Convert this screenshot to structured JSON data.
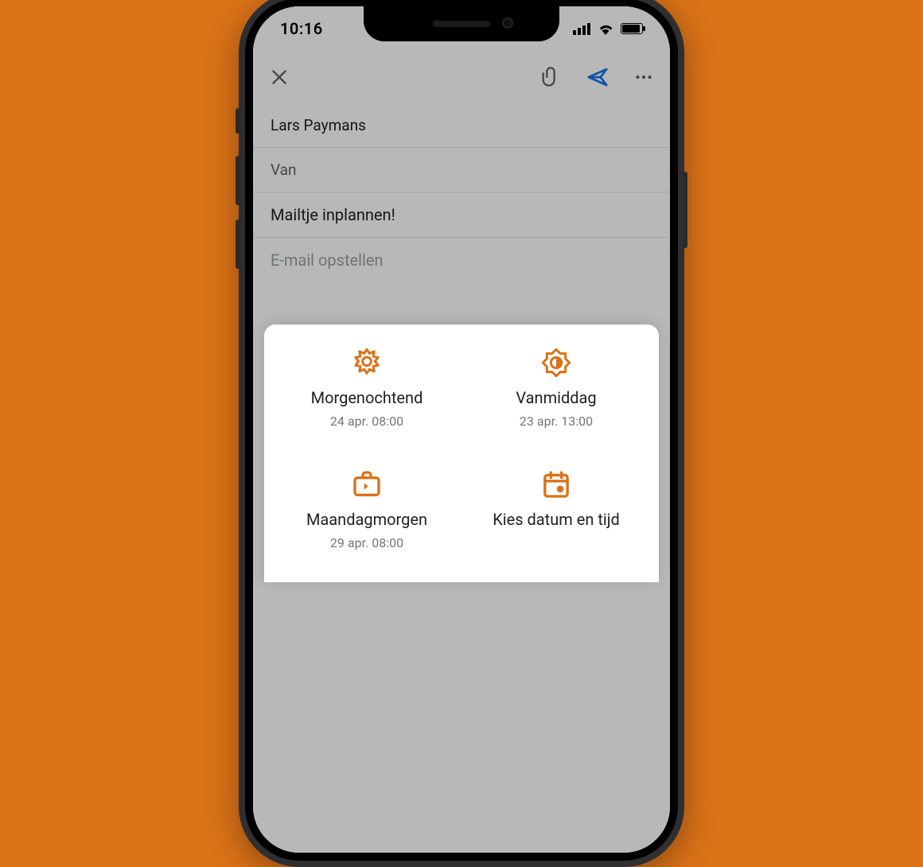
{
  "status": {
    "time": "10:16"
  },
  "compose": {
    "to": "Lars Paymans",
    "from_label": "Van",
    "subject": "Mailtje inplannen!",
    "body_placeholder": "E-mail opstellen"
  },
  "schedule_sheet": {
    "options": [
      {
        "icon": "sun",
        "title": "Morgenochtend",
        "subtitle": "24 apr. 08:00"
      },
      {
        "icon": "half-sun",
        "title": "Vanmiddag",
        "subtitle": "23 apr. 13:00"
      },
      {
        "icon": "briefcase",
        "title": "Maandagmorgen",
        "subtitle": "29 apr. 08:00"
      },
      {
        "icon": "calendar",
        "title": "Kies datum en tijd",
        "subtitle": ""
      }
    ]
  },
  "colors": {
    "accent": "#da7218",
    "send": "#1a73e8"
  }
}
